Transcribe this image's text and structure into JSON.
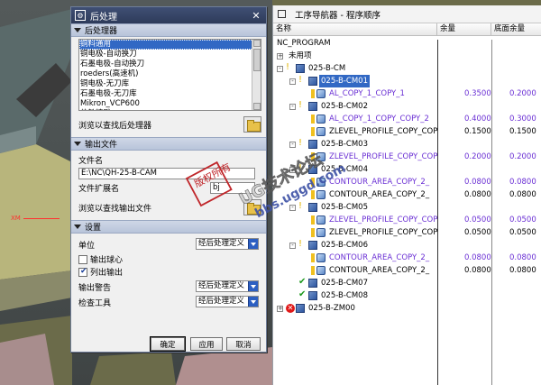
{
  "dialog": {
    "title": "后处理",
    "sections": {
      "postprocessor": "后处理器",
      "output_file": "输出文件",
      "settings": "设置"
    },
    "postprocessors": [
      {
        "label": "铜料通用",
        "selected": true
      },
      {
        "label": "铜电极-自动换刀",
        "selected": false
      },
      {
        "label": "石墨电极-自动换刀",
        "selected": false
      },
      {
        "label": "roeders(高速机)",
        "selected": false
      },
      {
        "label": "铜电极-无刀库",
        "selected": false
      },
      {
        "label": "石墨电极-无刀库",
        "selected": false
      },
      {
        "label": "Mikron_VCP600",
        "selected": false
      },
      {
        "label": "佳铁精雕",
        "selected": false
      }
    ],
    "browse_postprocessor": "浏览以查找后处理器",
    "file_name_label": "文件名",
    "file_name_value": "E:\\NC\\QH-25-B-CAM",
    "file_ext_label": "文件扩展名",
    "file_ext_value": "bj",
    "browse_output": "浏览以查找输出文件",
    "unit_label": "单位",
    "unit_value": "经后处理定义",
    "output_ball_center": "输出球心",
    "list_output": "列出输出",
    "output_warning_label": "输出警告",
    "output_warning_value": "经后处理定义",
    "inspect_tool_label": "检查工具",
    "inspect_tool_value": "经后处理定义",
    "ok": "确定",
    "apply": "应用",
    "cancel": "取消"
  },
  "viewport": {
    "axis_label": "XM"
  },
  "navigator": {
    "title": "工序导航器 - 程序顺序",
    "columns": [
      "名称",
      "余量",
      "底面余量"
    ],
    "root": "NC_PROGRAM",
    "rows": [
      {
        "name": "未用项",
        "purple": false,
        "stock": "",
        "floor": ""
      },
      {
        "name": "025-B-CM",
        "purple": false,
        "stock": "",
        "floor": ""
      },
      {
        "name": "025-B-CM01",
        "purple": false,
        "stock": "",
        "floor": ""
      },
      {
        "name": "AL_COPY_1_COPY_1",
        "purple": true,
        "stock": "0.3500",
        "floor": "0.2000"
      },
      {
        "name": "025-B-CM02",
        "purple": false,
        "stock": "",
        "floor": ""
      },
      {
        "name": "AL_COPY_1_COPY_COPY_2",
        "purple": true,
        "stock": "0.4000",
        "floor": "0.3000"
      },
      {
        "name": "ZLEVEL_PROFILE_COPY_COP",
        "purple": false,
        "stock": "0.1500",
        "floor": "0.1500"
      },
      {
        "name": "025-B-CM03",
        "purple": false,
        "stock": "",
        "floor": ""
      },
      {
        "name": "ZLEVEL_PROFILE_COPY_COP",
        "purple": true,
        "stock": "0.2000",
        "floor": "0.2000"
      },
      {
        "name": "025-B-CM04",
        "purple": false,
        "stock": "",
        "floor": ""
      },
      {
        "name": "CONTOUR_AREA_COPY_2_",
        "purple": true,
        "stock": "0.0800",
        "floor": "0.0800"
      },
      {
        "name": "CONTOUR_AREA_COPY_2_",
        "purple": false,
        "stock": "0.0800",
        "floor": "0.0800"
      },
      {
        "name": "025-B-CM05",
        "purple": false,
        "stock": "",
        "floor": ""
      },
      {
        "name": "ZLEVEL_PROFILE_COPY_COP",
        "purple": true,
        "stock": "0.0500",
        "floor": "0.0500"
      },
      {
        "name": "ZLEVEL_PROFILE_COPY_COP",
        "purple": false,
        "stock": "0.0500",
        "floor": "0.0500"
      },
      {
        "name": "025-B-CM06",
        "purple": false,
        "stock": "",
        "floor": ""
      },
      {
        "name": "CONTOUR_AREA_COPY_2_",
        "purple": true,
        "stock": "0.0800",
        "floor": "0.0800"
      },
      {
        "name": "CONTOUR_AREA_COPY_2_",
        "purple": false,
        "stock": "0.0800",
        "floor": "0.0800"
      },
      {
        "name": "025-B-CM07",
        "purple": false,
        "stock": "",
        "floor": ""
      },
      {
        "name": "025-B-CM08",
        "purple": false,
        "stock": "",
        "floor": ""
      },
      {
        "name": "025-B-ZM00",
        "purple": false,
        "stock": "",
        "floor": ""
      }
    ]
  },
  "watermark": {
    "line1": "UG技术论坛",
    "line2": "bbs.uggd.com",
    "stamp": "版权所有"
  }
}
